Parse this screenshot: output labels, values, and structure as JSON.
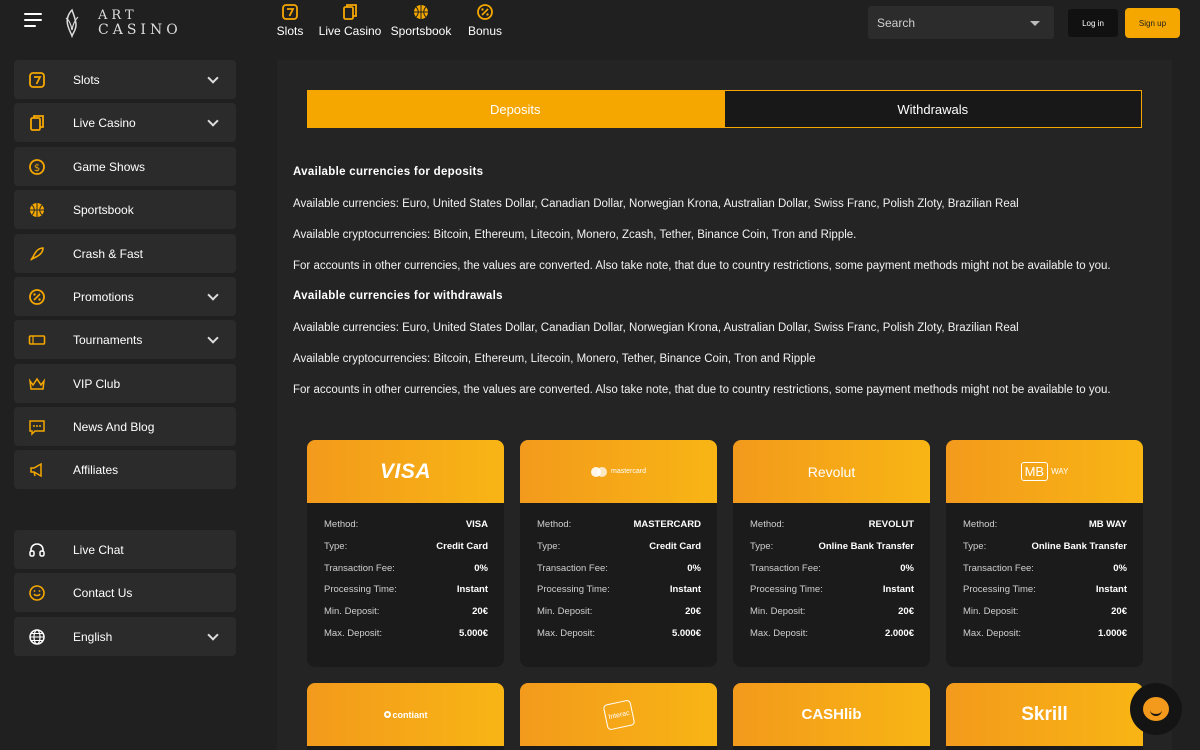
{
  "header": {
    "logo_line1": "ART",
    "logo_line2": "CASINO",
    "nav": [
      {
        "label": "Slots",
        "icon": "seven-icon"
      },
      {
        "label": "Live Casino",
        "icon": "cards-icon"
      },
      {
        "label": "Sportsbook",
        "icon": "basketball-icon"
      },
      {
        "label": "Bonus",
        "icon": "percent-icon"
      }
    ],
    "search_placeholder": "Search",
    "login_label": "Log in",
    "signup_label": "Sign up"
  },
  "sidebar": {
    "items": [
      {
        "label": "Slots",
        "icon": "seven-icon"
      },
      {
        "label": "Live Casino",
        "icon": "cards-icon"
      },
      {
        "label": "Game Shows",
        "icon": "dollar-coin-icon"
      },
      {
        "label": "Sportsbook",
        "icon": "basketball-icon"
      },
      {
        "label": "Crash & Fast",
        "icon": "rocket-icon"
      },
      {
        "label": "Promotions",
        "icon": "percent-icon"
      },
      {
        "label": "Tournaments",
        "icon": "ticket-icon"
      },
      {
        "label": "VIP Club",
        "icon": "crown-icon"
      },
      {
        "label": "News And Blog",
        "icon": "chat-dots-icon"
      },
      {
        "label": "Affiliates",
        "icon": "megaphone-icon"
      }
    ],
    "bottom": [
      {
        "label": "Live Chat",
        "icon": "headset-icon"
      },
      {
        "label": "Contact Us",
        "icon": "smile-chat-icon"
      },
      {
        "label": "English",
        "icon": "globe-icon"
      }
    ]
  },
  "tabs": {
    "deposits": "Deposits",
    "withdrawals": "Withdrawals"
  },
  "content": {
    "deposits_title": "Available currencies for deposits",
    "deposits_currencies": "Available currencies: Euro, United States Dollar, Canadian Dollar, Norwegian Krona, Australian Dollar, Swiss Franc, Polish Zloty, Brazilian Real",
    "deposits_crypto": "Available cryptocurrencies: Bitcoin, Ethereum, Litecoin, Monero, Zcash, Tether, Binance Coin, Tron and Ripple.",
    "deposits_note": "For accounts in other currencies, the values are converted. Also take note, that due to country restrictions, some payment methods might not be available to you.",
    "withdrawals_title": "Available currencies for withdrawals",
    "withdrawals_currencies": "Available currencies: Euro, United States Dollar, Canadian Dollar, Norwegian Krona, Australian Dollar, Swiss Franc, Polish Zloty, Brazilian Real",
    "withdrawals_crypto": "Available cryptocurrencies: Bitcoin, Ethereum, Litecoin, Monero, Tether, Binance Coin, Tron and Ripple",
    "withdrawals_note": "For accounts in other currencies, the values are converted. Also take note, that due to country restrictions, some payment methods might not be available to you."
  },
  "row_labels": {
    "method": "Method:",
    "type": "Type:",
    "fee": "Transaction Fee:",
    "time": "Processing Time:",
    "min": "Min. Deposit:",
    "max": "Max. Deposit:"
  },
  "cards": [
    {
      "brand": "VISA",
      "method": "VISA",
      "type": "Credit Card",
      "fee": "0%",
      "time": "Instant",
      "min": "20€",
      "max": "5.000€"
    },
    {
      "brand": "mastercard",
      "method": "MASTERCARD",
      "type": "Credit Card",
      "fee": "0%",
      "time": "Instant",
      "min": "20€",
      "max": "5.000€"
    },
    {
      "brand": "Revolut",
      "method": "REVOLUT",
      "type": "Online Bank Transfer",
      "fee": "0%",
      "time": "Instant",
      "min": "20€",
      "max": "2.000€"
    },
    {
      "brand_mb": "MB",
      "brand_way": "WAY",
      "method": "MB WAY",
      "type": "Online Bank Transfer",
      "fee": "0%",
      "time": "Instant",
      "min": "20€",
      "max": "1.000€"
    }
  ],
  "cards_row2": [
    {
      "brand": "contiant"
    },
    {
      "brand": "Interac"
    },
    {
      "brand": "CASHlib"
    },
    {
      "brand": "Skrill"
    }
  ],
  "colors": {
    "accent": "#f5a700",
    "background": "#202020",
    "panel": "#242424"
  }
}
